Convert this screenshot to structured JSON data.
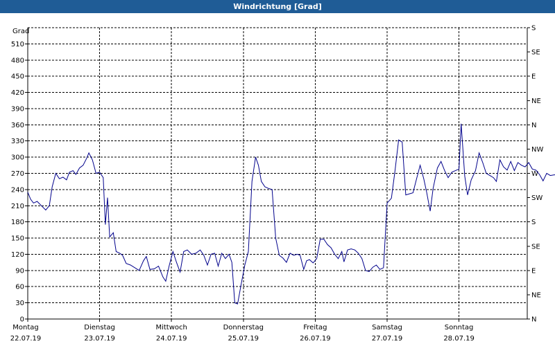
{
  "window": {
    "title": "Windrichtung [Grad]"
  },
  "colors": {
    "title_bar": "#1f5c96",
    "series_line": "#00008b",
    "grid": "#000000"
  },
  "chart_data": {
    "type": "line",
    "title": "Windrichtung [Grad]",
    "ylabel": "Grad",
    "xlabel": "",
    "ylim": [
      0,
      540
    ],
    "yticks": [
      0,
      30,
      60,
      90,
      120,
      150,
      180,
      210,
      240,
      270,
      300,
      330,
      360,
      390,
      420,
      450,
      480,
      510
    ],
    "right_axis": {
      "ticks": [
        {
          "value": 0,
          "label": "N"
        },
        {
          "value": 45,
          "label": "NE"
        },
        {
          "value": 90,
          "label": "E"
        },
        {
          "value": 135,
          "label": "SE"
        },
        {
          "value": 180,
          "label": "S"
        },
        {
          "value": 225,
          "label": "SW"
        },
        {
          "value": 270,
          "label": "W"
        },
        {
          "value": 315,
          "label": "NW"
        },
        {
          "value": 360,
          "label": "N"
        },
        {
          "value": 405,
          "label": "NE"
        },
        {
          "value": 450,
          "label": "E"
        },
        {
          "value": 495,
          "label": "SE"
        },
        {
          "value": 540,
          "label": "S"
        }
      ]
    },
    "xlim": [
      0,
      7
    ],
    "x_unit": "days",
    "days": [
      {
        "day": "Montag",
        "date": "22.07.19"
      },
      {
        "day": "Dienstag",
        "date": "23.07.19"
      },
      {
        "day": "Mittwoch",
        "date": "24.07.19"
      },
      {
        "day": "Donnerstag",
        "date": "25.07.19"
      },
      {
        "day": "Freitag",
        "date": "26.07.19"
      },
      {
        "day": "Samstag",
        "date": "27.07.19"
      },
      {
        "day": "Sonntag",
        "date": "28.07.19"
      }
    ],
    "grid": true,
    "series": [
      {
        "points": [
          [
            0.0,
            235
          ],
          [
            0.04,
            222
          ],
          [
            0.08,
            215
          ],
          [
            0.13,
            218
          ],
          [
            0.19,
            210
          ],
          [
            0.25,
            202
          ],
          [
            0.3,
            210
          ],
          [
            0.34,
            245
          ],
          [
            0.39,
            270
          ],
          [
            0.44,
            260
          ],
          [
            0.49,
            263
          ],
          [
            0.54,
            258
          ],
          [
            0.58,
            272
          ],
          [
            0.63,
            275
          ],
          [
            0.67,
            268
          ],
          [
            0.72,
            280
          ],
          [
            0.77,
            285
          ],
          [
            0.82,
            298
          ],
          [
            0.85,
            308
          ],
          [
            0.9,
            295
          ],
          [
            0.95,
            270
          ],
          [
            1.0,
            272
          ],
          [
            1.05,
            262
          ],
          [
            1.08,
            175
          ],
          [
            1.11,
            225
          ],
          [
            1.14,
            152
          ],
          [
            1.19,
            160
          ],
          [
            1.23,
            125
          ],
          [
            1.28,
            122
          ],
          [
            1.32,
            118
          ],
          [
            1.37,
            103
          ],
          [
            1.43,
            100
          ],
          [
            1.49,
            95
          ],
          [
            1.55,
            90
          ],
          [
            1.61,
            108
          ],
          [
            1.65,
            116
          ],
          [
            1.7,
            92
          ],
          [
            1.76,
            93
          ],
          [
            1.82,
            98
          ],
          [
            1.88,
            78
          ],
          [
            1.92,
            70
          ],
          [
            1.97,
            100
          ],
          [
            2.02,
            125
          ],
          [
            2.07,
            105
          ],
          [
            2.12,
            87
          ],
          [
            2.17,
            125
          ],
          [
            2.22,
            128
          ],
          [
            2.28,
            120
          ],
          [
            2.34,
            122
          ],
          [
            2.4,
            128
          ],
          [
            2.45,
            118
          ],
          [
            2.5,
            100
          ],
          [
            2.55,
            120
          ],
          [
            2.6,
            122
          ],
          [
            2.65,
            98
          ],
          [
            2.7,
            122
          ],
          [
            2.75,
            112
          ],
          [
            2.8,
            120
          ],
          [
            2.84,
            105
          ],
          [
            2.88,
            30
          ],
          [
            2.92,
            28
          ],
          [
            2.97,
            65
          ],
          [
            3.02,
            100
          ],
          [
            3.07,
            125
          ],
          [
            3.12,
            255
          ],
          [
            3.17,
            300
          ],
          [
            3.21,
            285
          ],
          [
            3.25,
            255
          ],
          [
            3.3,
            245
          ],
          [
            3.35,
            242
          ],
          [
            3.4,
            240
          ],
          [
            3.45,
            150
          ],
          [
            3.5,
            118
          ],
          [
            3.55,
            113
          ],
          [
            3.6,
            105
          ],
          [
            3.65,
            122
          ],
          [
            3.7,
            118
          ],
          [
            3.75,
            120
          ],
          [
            3.79,
            118
          ],
          [
            3.84,
            92
          ],
          [
            3.88,
            108
          ],
          [
            3.92,
            110
          ],
          [
            3.97,
            104
          ],
          [
            4.02,
            112
          ],
          [
            4.07,
            148
          ],
          [
            4.12,
            148
          ],
          [
            4.17,
            138
          ],
          [
            4.22,
            132
          ],
          [
            4.27,
            120
          ],
          [
            4.32,
            112
          ],
          [
            4.37,
            125
          ],
          [
            4.4,
            106
          ],
          [
            4.45,
            128
          ],
          [
            4.5,
            130
          ],
          [
            4.55,
            128
          ],
          [
            4.6,
            122
          ],
          [
            4.65,
            112
          ],
          [
            4.7,
            90
          ],
          [
            4.75,
            88
          ],
          [
            4.8,
            96
          ],
          [
            4.85,
            100
          ],
          [
            4.9,
            92
          ],
          [
            4.95,
            95
          ],
          [
            5.0,
            215
          ],
          [
            5.06,
            224
          ],
          [
            5.11,
            275
          ],
          [
            5.16,
            332
          ],
          [
            5.21,
            328
          ],
          [
            5.26,
            230
          ],
          [
            5.31,
            232
          ],
          [
            5.36,
            234
          ],
          [
            5.41,
            260
          ],
          [
            5.46,
            285
          ],
          [
            5.51,
            260
          ],
          [
            5.55,
            235
          ],
          [
            5.6,
            200
          ],
          [
            5.64,
            242
          ],
          [
            5.7,
            280
          ],
          [
            5.75,
            292
          ],
          [
            5.8,
            275
          ],
          [
            5.85,
            262
          ],
          [
            5.9,
            272
          ],
          [
            5.95,
            275
          ],
          [
            6.0,
            278
          ],
          [
            6.03,
            362
          ],
          [
            6.08,
            265
          ],
          [
            6.12,
            230
          ],
          [
            6.17,
            258
          ],
          [
            6.23,
            275
          ],
          [
            6.28,
            308
          ],
          [
            6.33,
            290
          ],
          [
            6.38,
            270
          ],
          [
            6.43,
            266
          ],
          [
            6.48,
            262
          ],
          [
            6.52,
            255
          ],
          [
            6.57,
            295
          ],
          [
            6.62,
            282
          ],
          [
            6.67,
            276
          ],
          [
            6.72,
            292
          ],
          [
            6.77,
            275
          ],
          [
            6.82,
            290
          ],
          [
            6.87,
            285
          ],
          [
            6.92,
            282
          ],
          [
            6.97,
            290
          ],
          [
            7.02,
            278
          ],
          [
            7.07,
            276
          ],
          [
            7.12,
            268
          ],
          [
            7.17,
            256
          ],
          [
            7.22,
            270
          ],
          [
            7.27,
            266
          ],
          [
            7.32,
            267
          ],
          [
            7.37,
            268
          ],
          [
            7.42,
            270
          ],
          [
            7.47,
            266
          ],
          [
            7.52,
            272
          ],
          [
            7.56,
            268
          ],
          [
            7.6,
            258
          ]
        ]
      }
    ]
  }
}
